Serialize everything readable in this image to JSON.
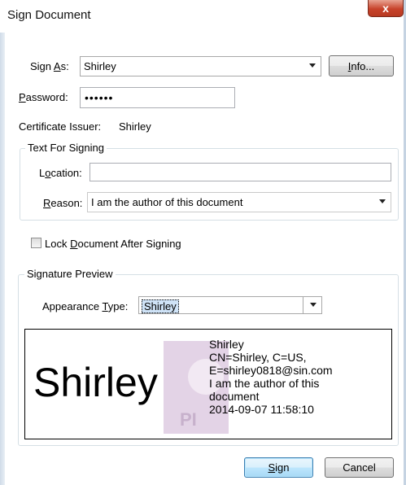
{
  "window": {
    "title": "Sign Document",
    "close_glyph": "x"
  },
  "sign_as": {
    "label_pre": "Sign ",
    "label_key": "A",
    "label_post": "s:",
    "value": "Shirley",
    "info_button": {
      "pre": "",
      "key": "I",
      "post": "nfo..."
    }
  },
  "password": {
    "label_key": "P",
    "label_post": "assword:",
    "value": "••••••"
  },
  "certificate": {
    "label": "Certificate Issuer:",
    "value": "Shirley"
  },
  "text_for_signing": {
    "legend": "Text For Signing",
    "location": {
      "label_pre": "L",
      "label_key": "o",
      "label_post": "cation:",
      "value": ""
    },
    "reason": {
      "label_pre": "",
      "label_key": "R",
      "label_post": "eason:",
      "value": "I am the author of this document"
    }
  },
  "lock_document": {
    "label_pre": "Lock ",
    "label_key": "D",
    "label_post": "ocument After Signing",
    "checked": false
  },
  "signature_preview": {
    "legend": "Signature Preview",
    "appearance_type": {
      "label_pre": "Appearance ",
      "label_key": "T",
      "label_post": "ype:",
      "value": "Shirley"
    },
    "name_large": "Shirley",
    "details": [
      "Shirley",
      "CN=Shirley, C=US,",
      "E=shirley0818@sin.com",
      "I am the author of this",
      "document",
      "2014-09-07 11:58:10"
    ],
    "watermark_text": "PI"
  },
  "buttons": {
    "sign": {
      "pre": "",
      "key": "S",
      "post": "ign"
    },
    "cancel": "Cancel"
  },
  "colors": {
    "default_button_border": "#3c7fb1",
    "close_button": "#c7432b",
    "watermark": "#d8c6dc"
  }
}
